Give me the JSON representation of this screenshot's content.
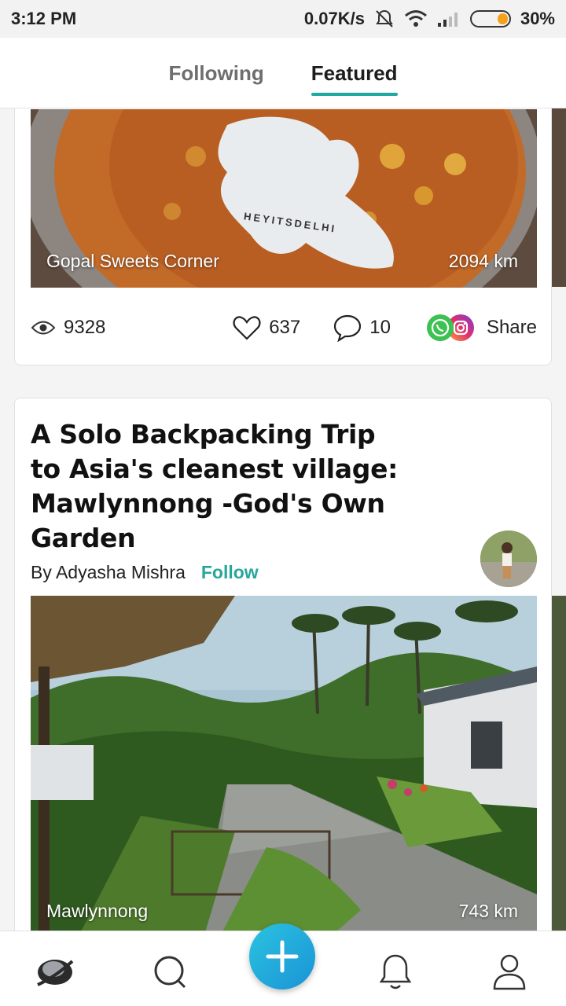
{
  "status_bar": {
    "time": "3:12 PM",
    "network_speed": "0.07K/s",
    "battery": "30%",
    "battery_level": 0.3,
    "icons": [
      "mute-bell-icon",
      "wifi-icon",
      "signal-icon",
      "battery-icon"
    ]
  },
  "tabs": [
    {
      "label": "Following",
      "active": false
    },
    {
      "label": "Featured",
      "active": true
    }
  ],
  "accent_color": "#1fa9a0",
  "cards": [
    {
      "place": "Gopal Sweets Corner",
      "distance": "2094 km",
      "watermark": "HEYITSDELHI",
      "views": "9328",
      "likes": "637",
      "comments": "10",
      "share_label": "Share"
    },
    {
      "title": "A Solo Backpacking Trip to Asia's cleanest village: Mawlynnong -God's Own Garden",
      "byline": "By Adyasha Mishra",
      "follow_label": "Follow",
      "place": "Mawlynnong",
      "distance": "743 km"
    }
  ],
  "bottom_nav": [
    "home-icon",
    "search-icon",
    "add-icon",
    "notifications-icon",
    "profile-icon"
  ]
}
